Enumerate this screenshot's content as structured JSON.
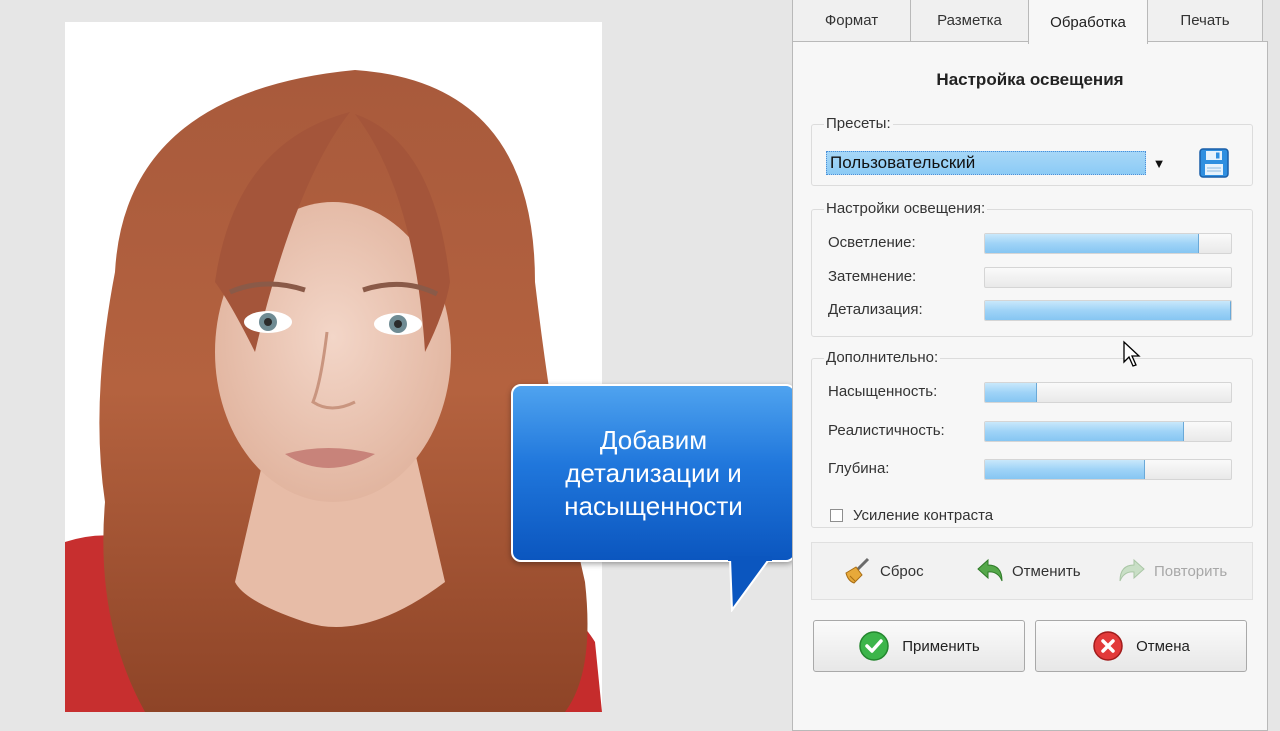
{
  "tabs": [
    {
      "label": "Формат",
      "active": false
    },
    {
      "label": "Разметка",
      "active": false
    },
    {
      "label": "Обработка",
      "active": true
    },
    {
      "label": "Печать",
      "active": false
    }
  ],
  "panel": {
    "title": "Настройка освещения",
    "presets": {
      "label": "Пресеты:",
      "selected": "Пользовательский"
    },
    "lighting": {
      "label": "Настройки освещения:",
      "sliders": [
        {
          "label": "Осветление:",
          "value": 0.87
        },
        {
          "label": "Затемнение:",
          "value": 0.0
        },
        {
          "label": "Детализация:",
          "value": 1.0
        }
      ]
    },
    "extra": {
      "label": "Дополнительно:",
      "sliders": [
        {
          "label": "Насыщенность:",
          "value": 0.21
        },
        {
          "label": "Реалистичность:",
          "value": 0.81
        },
        {
          "label": "Глубина:",
          "value": 0.65
        }
      ],
      "checkbox_label": "Усиление контраста",
      "checkbox_checked": false
    },
    "actions": {
      "reset": "Сброс",
      "undo": "Отменить",
      "redo": "Повторить"
    },
    "apply_label": "Применить",
    "cancel_label": "Отмена"
  },
  "callout": {
    "text": "Добавим детализации и насыщенности"
  },
  "colors": {
    "accent": "#2077dc",
    "slider_fill": "#9fd3f7",
    "apply_green": "#3cb54a",
    "cancel_red": "#e23a3a"
  }
}
